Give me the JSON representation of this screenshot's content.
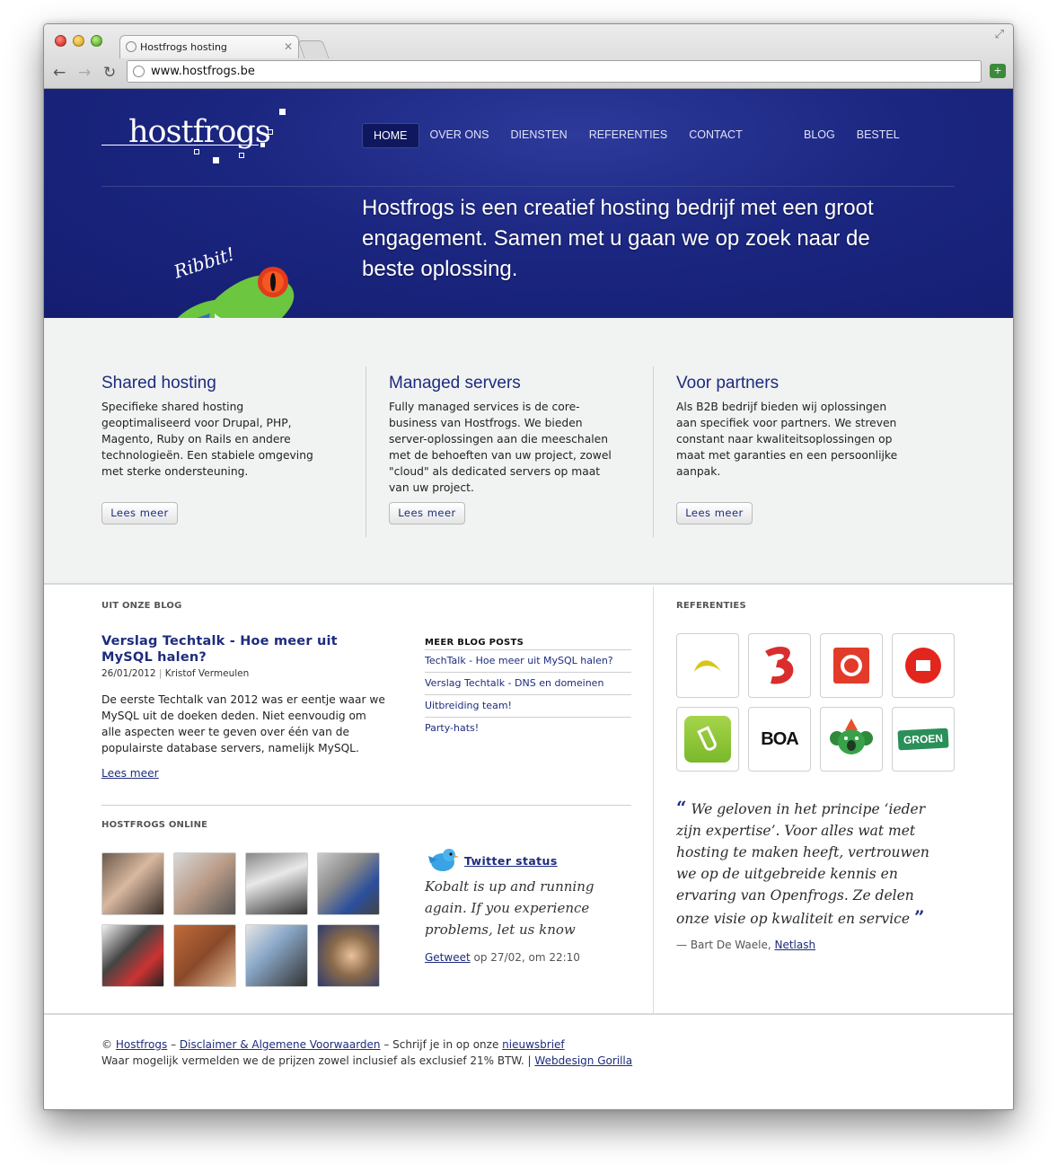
{
  "browser": {
    "tab_title": "Hostfrogs hosting",
    "url": "www.hostfrogs.be"
  },
  "site": {
    "logo_text": "hostfrogs",
    "nav": [
      {
        "label": "HOME",
        "active": true
      },
      {
        "label": "OVER ONS",
        "active": false
      },
      {
        "label": "DIENSTEN",
        "active": false
      },
      {
        "label": "REFERENTIES",
        "active": false
      },
      {
        "label": "CONTACT",
        "active": false
      }
    ],
    "nav_right": [
      "BLOG",
      "BESTEL"
    ],
    "tagline": "Hostfrogs is een creatief hosting bedrijf met een groot engagement. Samen met u gaan we op zoek naar de beste oplossing.",
    "frog_caption": "Ribbit!"
  },
  "services": [
    {
      "title": "Shared hosting",
      "text": "Specifieke shared hosting geoptimaliseerd voor Drupal, PHP, Magento, Ruby on Rails en andere technologieën. Een stabiele omgeving met sterke ondersteuning.",
      "button": "Lees meer"
    },
    {
      "title": "Managed servers",
      "text": "Fully managed services is de core-business van Hostfrogs. We bieden server-oplossingen aan die meeschalen met de behoeften van uw project, zowel \"cloud\" als dedicated servers op maat van uw project.",
      "button": "Lees meer"
    },
    {
      "title": "Voor partners",
      "text": "Als B2B bedrijf bieden wij oplossingen aan specifiek voor partners. We streven constant naar kwaliteitsoplossingen op maat met garanties en een persoonlijke aanpak.",
      "button": "Lees meer"
    }
  ],
  "blog": {
    "label": "UIT ONZE BLOG",
    "post_title": "Verslag Techtalk - Hoe meer uit MySQL halen?",
    "post_date": "26/01/2012",
    "post_author": "Kristof Vermeulen",
    "post_body": "De eerste Techtalk van 2012 was er eentje waar we MySQL uit de doeken deden. Niet eenvoudig om alle aspecten weer te geven over één van de populairste database servers, namelijk MySQL.",
    "read_more": "Lees meer",
    "more_label": "MEER BLOG POSTS",
    "more_posts": [
      "TechTalk - Hoe meer uit MySQL halen?",
      "Verslag Techtalk - DNS en domeinen",
      "Uitbreiding team!",
      "Party-hats!"
    ]
  },
  "online": {
    "label": "HOSTFROGS ONLINE",
    "twitter_title": "Twitter status",
    "tweet": "Kobalt is up and running again. If you experience problems, let us know",
    "tweet_link": "Getweet",
    "tweet_time": "op 27/02, om 22:10"
  },
  "references": {
    "label": "REFERENTIES",
    "logos": [
      "banana-logo",
      "red-3-logo",
      "red-square-logo",
      "red-circle-logo",
      "green-glass-logo",
      "boa-logo",
      "koala-logo",
      "groen-logo"
    ],
    "logo_texts": {
      "boa": "BOA",
      "groen": "GROEN"
    },
    "quote": "We geloven in het principe ‘ieder zijn expertise’. Voor alles wat met hosting te maken heeft, vertrouwen we op de uitgebreide kennis en ervaring van Openfrogs. Ze delen onze visie op kwaliteit en service",
    "quote_open": "“",
    "quote_close": "”",
    "author_prefix": "— Bart De Waele,",
    "author_company": "Netlash"
  },
  "footer": {
    "copyright": "©",
    "brand_link": "Hostfrogs",
    "sep1": "–",
    "disclaimer_link": "Disclaimer & Algemene Voorwaarden",
    "sep2": "– Schrijf je in op onze",
    "newsletter_link": "nieuwsbrief",
    "line2": "Waar mogelijk vermelden we de prijzen zowel inclusief als exclusief 21% BTW. |",
    "webdesign_link": "Webdesign Gorilla"
  },
  "colors": {
    "brand_blue": "#1b2680",
    "link_blue": "#1d2c7e",
    "frog_green": "#5fbf3c"
  }
}
